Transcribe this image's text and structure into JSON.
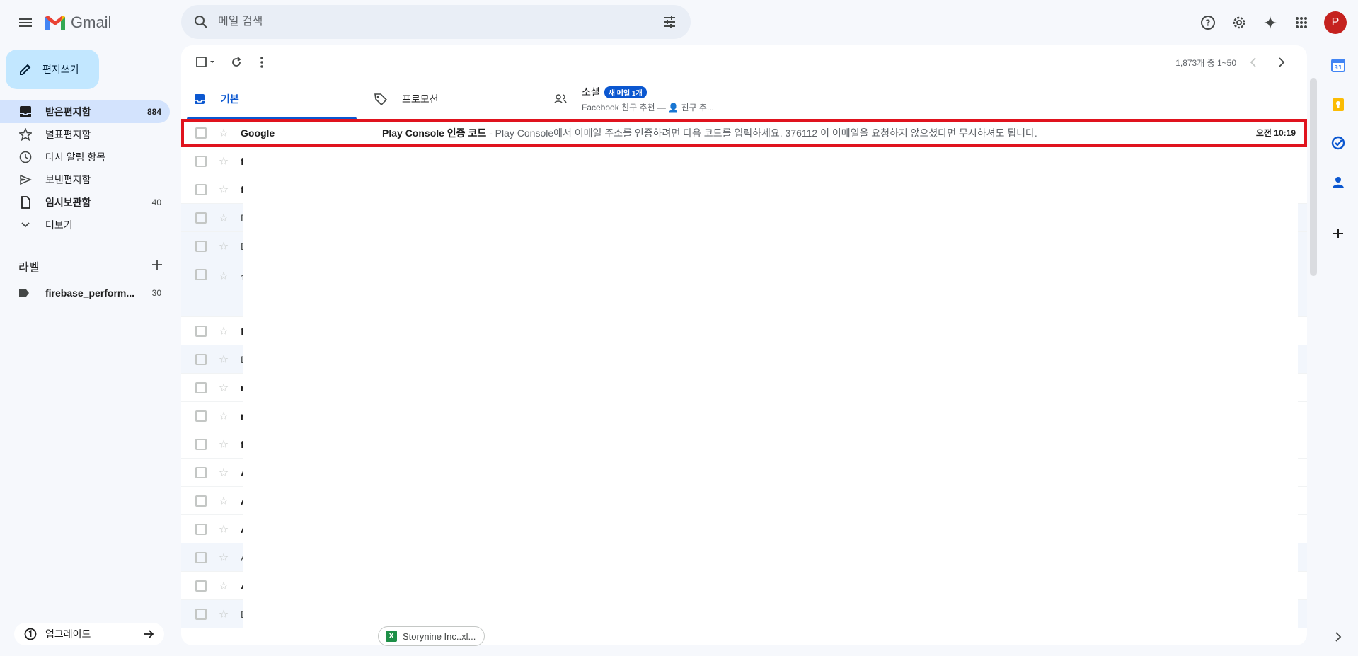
{
  "app": {
    "name": "Gmail"
  },
  "search": {
    "placeholder": "메일 검색"
  },
  "user": {
    "initial": "P"
  },
  "compose": {
    "label": "편지쓰기"
  },
  "nav": {
    "items": [
      {
        "label": "받은편지함",
        "count": "884"
      },
      {
        "label": "별표편지함",
        "count": ""
      },
      {
        "label": "다시 알림 항목",
        "count": ""
      },
      {
        "label": "보낸편지함",
        "count": ""
      },
      {
        "label": "임시보관함",
        "count": "40"
      },
      {
        "label": "더보기",
        "count": ""
      }
    ]
  },
  "labels": {
    "heading": "라벨",
    "items": [
      {
        "label": "firebase_perform...",
        "count": "30"
      }
    ]
  },
  "upgrade": {
    "label": "업그레이드"
  },
  "pager": {
    "text": "1,873개 중 1~50"
  },
  "tabs": [
    {
      "label": "기본"
    },
    {
      "label": "프로모션"
    },
    {
      "label": "소셜",
      "badge": "새 메일 1개",
      "sub": "Facebook 친구 추천 — 👤 친구 추..."
    }
  ],
  "emails": [
    {
      "sender": "Google",
      "subject": "Play Console 인증 코드",
      "snippet": " - Play Console에서 이메일 주소를 인증하려면 다음 코드를 입력하세요. 376112 이 이메일을 요청하지 않으셨다면 무시하셔도 됩니다.",
      "time": "오전 10:19"
    },
    {
      "sender": "fir"
    },
    {
      "sender": "fir"
    },
    {
      "sender": "Du"
    },
    {
      "sender": "D&"
    },
    {
      "sender": "김"
    },
    {
      "sender": "fir"
    },
    {
      "sender": "D&"
    },
    {
      "sender": "nc"
    },
    {
      "sender": "nc"
    },
    {
      "sender": "fir"
    },
    {
      "sender": "Ap"
    },
    {
      "sender": "Ap"
    },
    {
      "sender": "Ap"
    },
    {
      "sender": "Ap"
    },
    {
      "sender": "Ap"
    },
    {
      "sender": "Du"
    }
  ],
  "attachment": {
    "name": "Storynine Inc..xl..."
  },
  "colors": {
    "accent": "#0b57d0",
    "highlight": "#e0131e",
    "compose_bg": "#c2e7ff",
    "nav_active": "#d3e3fd"
  }
}
